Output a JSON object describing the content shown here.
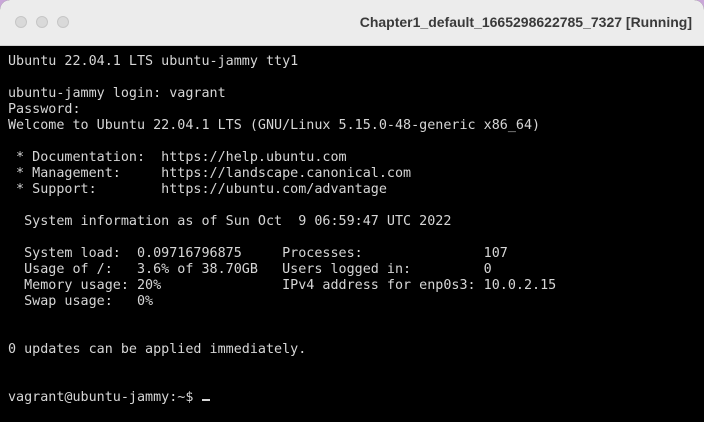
{
  "window": {
    "title": "Chapter1_default_1665298622785_7327 [Running]"
  },
  "terminal": {
    "lines": [
      "Ubuntu 22.04.1 LTS ubuntu-jammy tty1",
      "ubuntu-jammy login: vagrant",
      "Password:",
      "Welcome to Ubuntu 22.04.1 LTS (GNU/Linux 5.15.0-48-generic x86_64)",
      " * Documentation:  https://help.ubuntu.com",
      " * Management:     https://landscape.canonical.com",
      " * Support:        https://ubuntu.com/advantage",
      "  System information as of Sun Oct  9 06:59:47 UTC 2022",
      "  System load:  0.09716796875     Processes:               107",
      "  Usage of /:   3.6% of 38.70GB   Users logged in:         0",
      "  Memory usage: 20%               IPv4 address for enp0s3: 10.0.2.15",
      "  Swap usage:   0%",
      "0 updates can be applied immediately."
    ],
    "prompt": "vagrant@ubuntu-jammy:~$ "
  }
}
